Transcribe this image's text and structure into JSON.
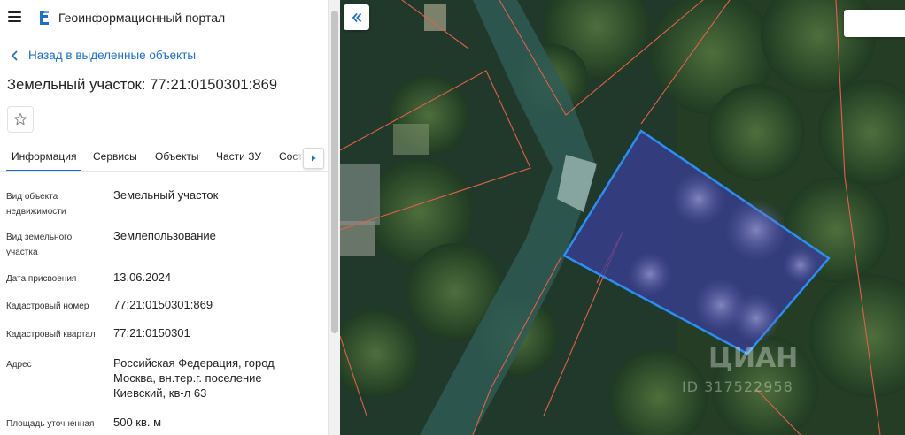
{
  "header": {
    "app_title": "Геоинформационный портал",
    "menu_icon": "hamburger-menu-icon",
    "logo_icon": "portal-logo-icon"
  },
  "navigation": {
    "back_label": "Назад в выделенные объекты"
  },
  "object": {
    "title": "Земельный участок: 77:21:0150301:869"
  },
  "tabs": [
    {
      "label": "Информация",
      "active": true
    },
    {
      "label": "Сервисы",
      "active": false
    },
    {
      "label": "Объекты",
      "active": false
    },
    {
      "label": "Части ЗУ",
      "active": false
    },
    {
      "label": "Соста",
      "active": false
    }
  ],
  "fields": [
    {
      "label": "Вид объекта недвижимости",
      "value": "Земельный участок"
    },
    {
      "label": "Вид земельного участка",
      "value": "Землепользование"
    },
    {
      "label": "Дата присвоения",
      "value": "13.06.2024"
    },
    {
      "label": "Кадастровый номер",
      "value": "77:21:0150301:869"
    },
    {
      "label": "Кадастровый квартал",
      "value": "77:21:0150301"
    },
    {
      "label": "Адрес",
      "value": "Российская Федерация, город Москва, вн.тер.г. поселение Киевский, кв-л 63"
    },
    {
      "label": "Площадь уточненная",
      "value": "500 кв. м"
    }
  ],
  "map": {
    "parcel_fill": "#3a3d9a",
    "parcel_stroke": "#2b8ef0",
    "boundary_color": "#e0604a",
    "watermark_brand": "ЦИАН",
    "watermark_id": "ID 317522958"
  },
  "colors": {
    "accent": "#1a6fd1"
  }
}
